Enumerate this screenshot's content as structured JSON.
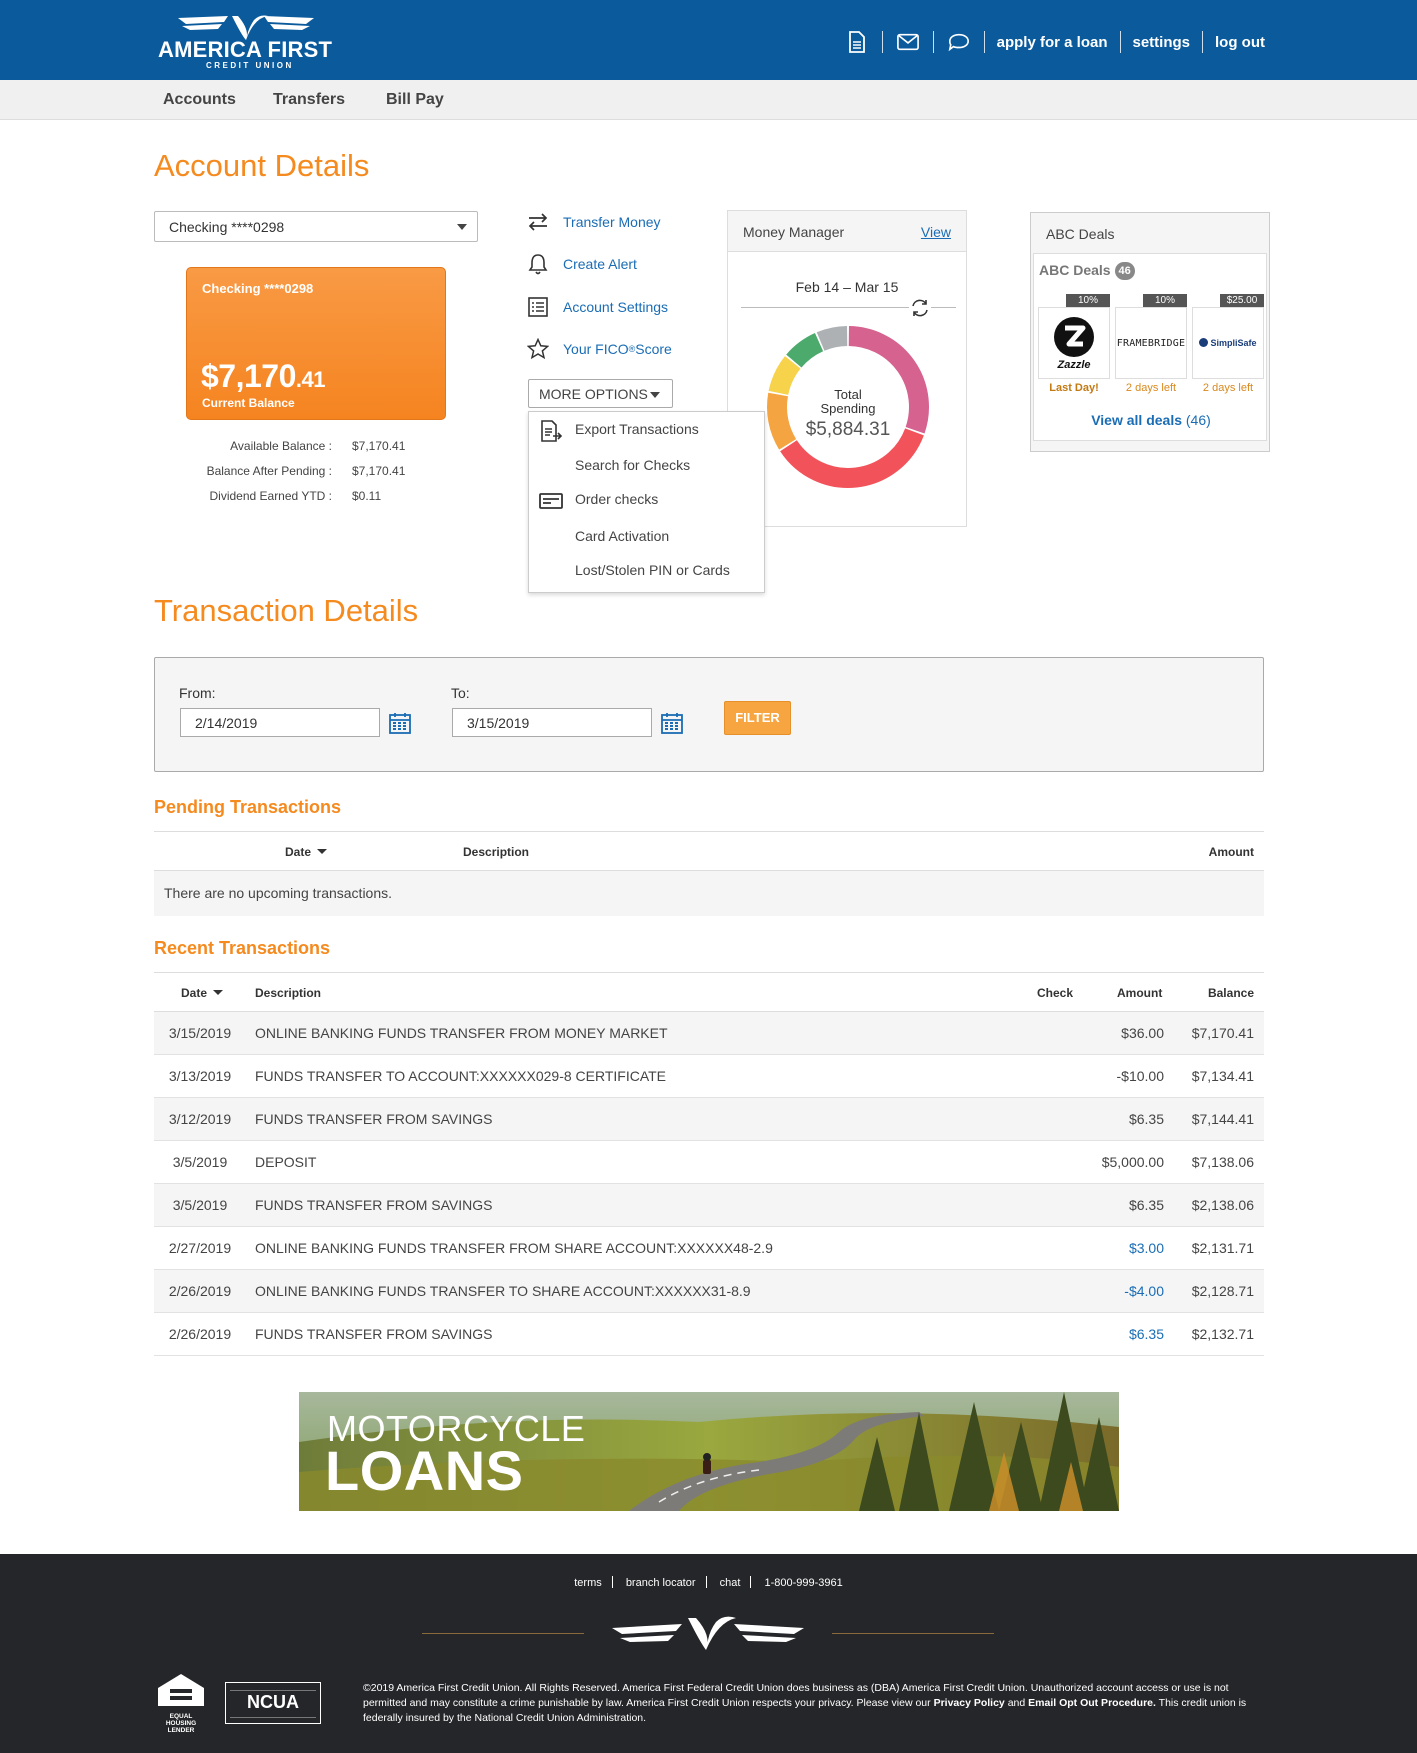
{
  "header": {
    "logo_name": "AMERICA FIRST",
    "logo_sub": "CREDIT UNION",
    "icons": [
      "document-icon",
      "mail-icon",
      "chat-icon"
    ],
    "links": [
      "apply for a loan",
      "settings",
      "log out"
    ]
  },
  "nav": {
    "items": [
      "Accounts",
      "Transfers",
      "Bill Pay"
    ]
  },
  "account": {
    "title": "Account Details",
    "select_value": "Checking ****0298",
    "card": {
      "name": "Checking ****0298",
      "balance_dollars": "$7,170",
      "balance_cents": ".41",
      "balance_label": "Current Balance"
    },
    "details": [
      {
        "label": "Available Balance :",
        "value": "$7,170.41"
      },
      {
        "label": "Balance After Pending :",
        "value": "$7,170.41"
      },
      {
        "label": "Dividend Earned YTD :",
        "value": "$0.11"
      }
    ]
  },
  "actions": {
    "items": [
      {
        "label": "Transfer Money",
        "icon": "transfer-icon"
      },
      {
        "label": "Create Alert",
        "icon": "bell-icon"
      },
      {
        "label": "Account Settings",
        "icon": "list-icon"
      },
      {
        "label": "Your FICO",
        "sup": "®",
        "label_tail": " Score",
        "icon": "star-icon"
      }
    ],
    "more_options_label": "MORE OPTIONS",
    "menu": [
      "Export Transactions",
      "Search for Checks",
      "Order checks",
      "Card Activation",
      "Lost/Stolen PIN or Cards"
    ]
  },
  "money_manager": {
    "title": "Money Manager",
    "view_label": "View",
    "date_range": "Feb 14 – Mar 15",
    "total_label_1": "Total",
    "total_label_2": "Spending",
    "total_value": "$5,884.31",
    "segments": [
      {
        "fraction": 0.305,
        "color": "#d6628f"
      },
      {
        "fraction": 0.355,
        "color": "#f2535b"
      },
      {
        "fraction": 0.12,
        "color": "#f5a442"
      },
      {
        "fraction": 0.08,
        "color": "#f7d24b"
      },
      {
        "fraction": 0.075,
        "color": "#4caa6c"
      },
      {
        "fraction": 0.065,
        "color": "#adb1b4"
      }
    ]
  },
  "deals": {
    "title": "ABC Deals",
    "inner_title": "ABC Deals",
    "count": "46",
    "items": [
      {
        "tag": "10%",
        "brand": "Zazzle",
        "label": "Last Day!"
      },
      {
        "tag": "10%",
        "brand": "FRAMEBRIDGE",
        "label": "2 days left"
      },
      {
        "tag": "$25.00",
        "brand": "SimpliSafe",
        "label": "2 days left"
      }
    ],
    "view_all": "View all deals",
    "view_all_count": "(46)"
  },
  "transactions": {
    "title": "Transaction Details",
    "from_label": "From:",
    "from_value": "2/14/2019",
    "to_label": "To:",
    "to_value": "3/15/2019",
    "filter_label": "FILTER",
    "pending": {
      "title": "Pending Transactions",
      "columns": [
        "Date",
        "Description",
        "Amount"
      ],
      "empty_message": "There are no upcoming transactions."
    },
    "recent": {
      "title": "Recent Transactions",
      "columns": [
        "Date",
        "Description",
        "Check",
        "Amount",
        "Balance"
      ],
      "rows": [
        {
          "date": "3/15/2019",
          "description": "ONLINE BANKING FUNDS TRANSFER FROM MONEY MARKET",
          "check": "",
          "amount": "$36.00",
          "balance": "$7,170.41",
          "pending": false
        },
        {
          "date": "3/13/2019",
          "description": "FUNDS TRANSFER TO ACCOUNT:XXXXXX029-8 CERTIFICATE",
          "check": "",
          "amount": "-$10.00",
          "balance": "$7,134.41",
          "pending": false
        },
        {
          "date": "3/12/2019",
          "description": "FUNDS TRANSFER FROM SAVINGS",
          "check": "",
          "amount": "$6.35",
          "balance": "$7,144.41",
          "pending": false
        },
        {
          "date": "3/5/2019",
          "description": "DEPOSIT",
          "check": "",
          "amount": "$5,000.00",
          "balance": "$7,138.06",
          "pending": false
        },
        {
          "date": "3/5/2019",
          "description": "FUNDS TRANSFER FROM SAVINGS",
          "check": "",
          "amount": "$6.35",
          "balance": "$2,138.06",
          "pending": false
        },
        {
          "date": "2/27/2019",
          "description": "ONLINE BANKING FUNDS TRANSFER FROM SHARE ACCOUNT:XXXXXX48-2.9",
          "check": "",
          "amount": "$3.00",
          "balance": "$2,131.71",
          "pending": true
        },
        {
          "date": "2/26/2019",
          "description": "ONLINE BANKING FUNDS TRANSFER TO SHARE ACCOUNT:XXXXXX31-8.9",
          "check": "",
          "amount": "-$4.00",
          "balance": "$2,128.71",
          "pending": true
        },
        {
          "date": "2/26/2019",
          "description": "FUNDS TRANSFER FROM SAVINGS",
          "check": "",
          "amount": "$6.35",
          "balance": "$2,132.71",
          "pending": true
        }
      ]
    }
  },
  "banner": {
    "line1": "MOTORCYCLE",
    "line2": "LOANS"
  },
  "footer": {
    "links": [
      "terms",
      "branch locator",
      "chat",
      "1-800-999-3961"
    ],
    "ehl_text": "EQUAL HOUSING LENDER",
    "ncua_text": "NCUA",
    "legal_1": "©2019 America First Credit Union. All Rights Reserved. America First Federal Credit Union does business as (DBA) America First Credit Union. Unauthorized account access or use is not permitted and may constitute a crime punishable by law. America First Credit Union respects your privacy. Please view our ",
    "privacy_link": "Privacy Policy",
    "legal_and": " and ",
    "optout_link": "Email Opt Out Procedure.",
    "legal_2": " This credit union is federally insured by the National Credit Union Administration."
  },
  "colors": {
    "brand_blue": "#0a5a9c",
    "accent_orange": "#f58a1f",
    "link_blue": "#1a6db5",
    "footer_bg": "#252629"
  }
}
